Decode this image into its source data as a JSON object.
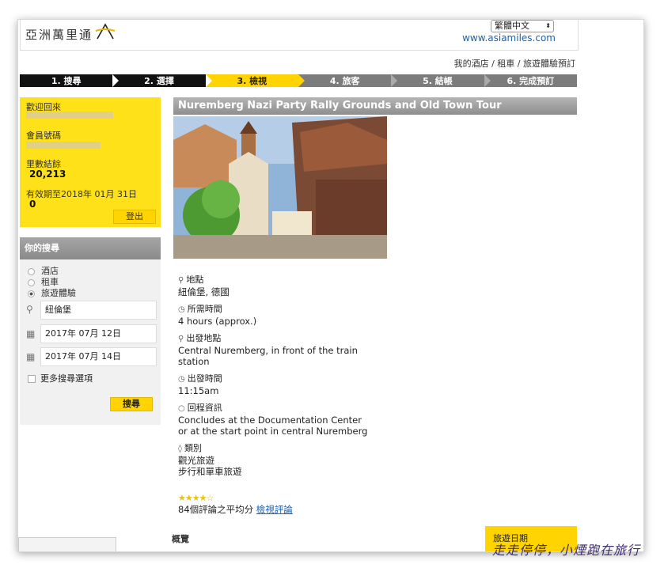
{
  "header": {
    "logo_text": "亞洲萬里通",
    "language": "繁體中文",
    "site": "www.asiamiles.com",
    "top_links": "我的酒店 / 租車 / 旅遊體驗預訂"
  },
  "steps": [
    "1. 搜尋",
    "2. 選擇",
    "3. 檢視",
    "4. 旅客",
    "5. 結帳",
    "6. 完成預訂"
  ],
  "welcome": {
    "greeting": "歡迎回來",
    "member_no_label": "會員號碼",
    "balance_label": "里數結餘",
    "balance": "20,213",
    "expiry_label": "有效期至2018年 01月 31日",
    "expiry_value": "0",
    "logout": "登出"
  },
  "search": {
    "title": "你的搜尋",
    "options": [
      "酒店",
      "租車",
      "旅遊體驗"
    ],
    "selected": "旅遊體驗",
    "location": "紐倫堡",
    "date_from": "2017年 07月 12日",
    "date_to": "2017年 07月 14日",
    "more_options": "更多搜尋選項",
    "search_button": "搜尋"
  },
  "tour": {
    "title": "Nuremberg Nazi Party Rally Grounds and Old Town Tour",
    "location_label": "地點",
    "location": "紐倫堡, 德國",
    "duration_label": "所需時間",
    "duration": "4 hours (approx.)",
    "departure_point_label": "出發地點",
    "departure_point": "Central Nuremberg, in front of the train station",
    "departure_time_label": "出發時間",
    "departure_time": "11:15am",
    "return_label": "回程資訊",
    "return_info": "Concludes at the Documentation Center or at the start point in central Nuremberg",
    "category_label": "類別",
    "category_1": "觀光旅遊",
    "category_2": "步行和單車旅遊",
    "rating": 4.5,
    "review_text": "84個評論之平均分",
    "review_link": "檢視評論",
    "overview_label": "概覽",
    "date_button": "旅遊日期"
  },
  "watermark": "走走停停，小煙跑在旅行",
  "colors": {
    "accent": "#ffd400",
    "link": "#1a62b3"
  }
}
